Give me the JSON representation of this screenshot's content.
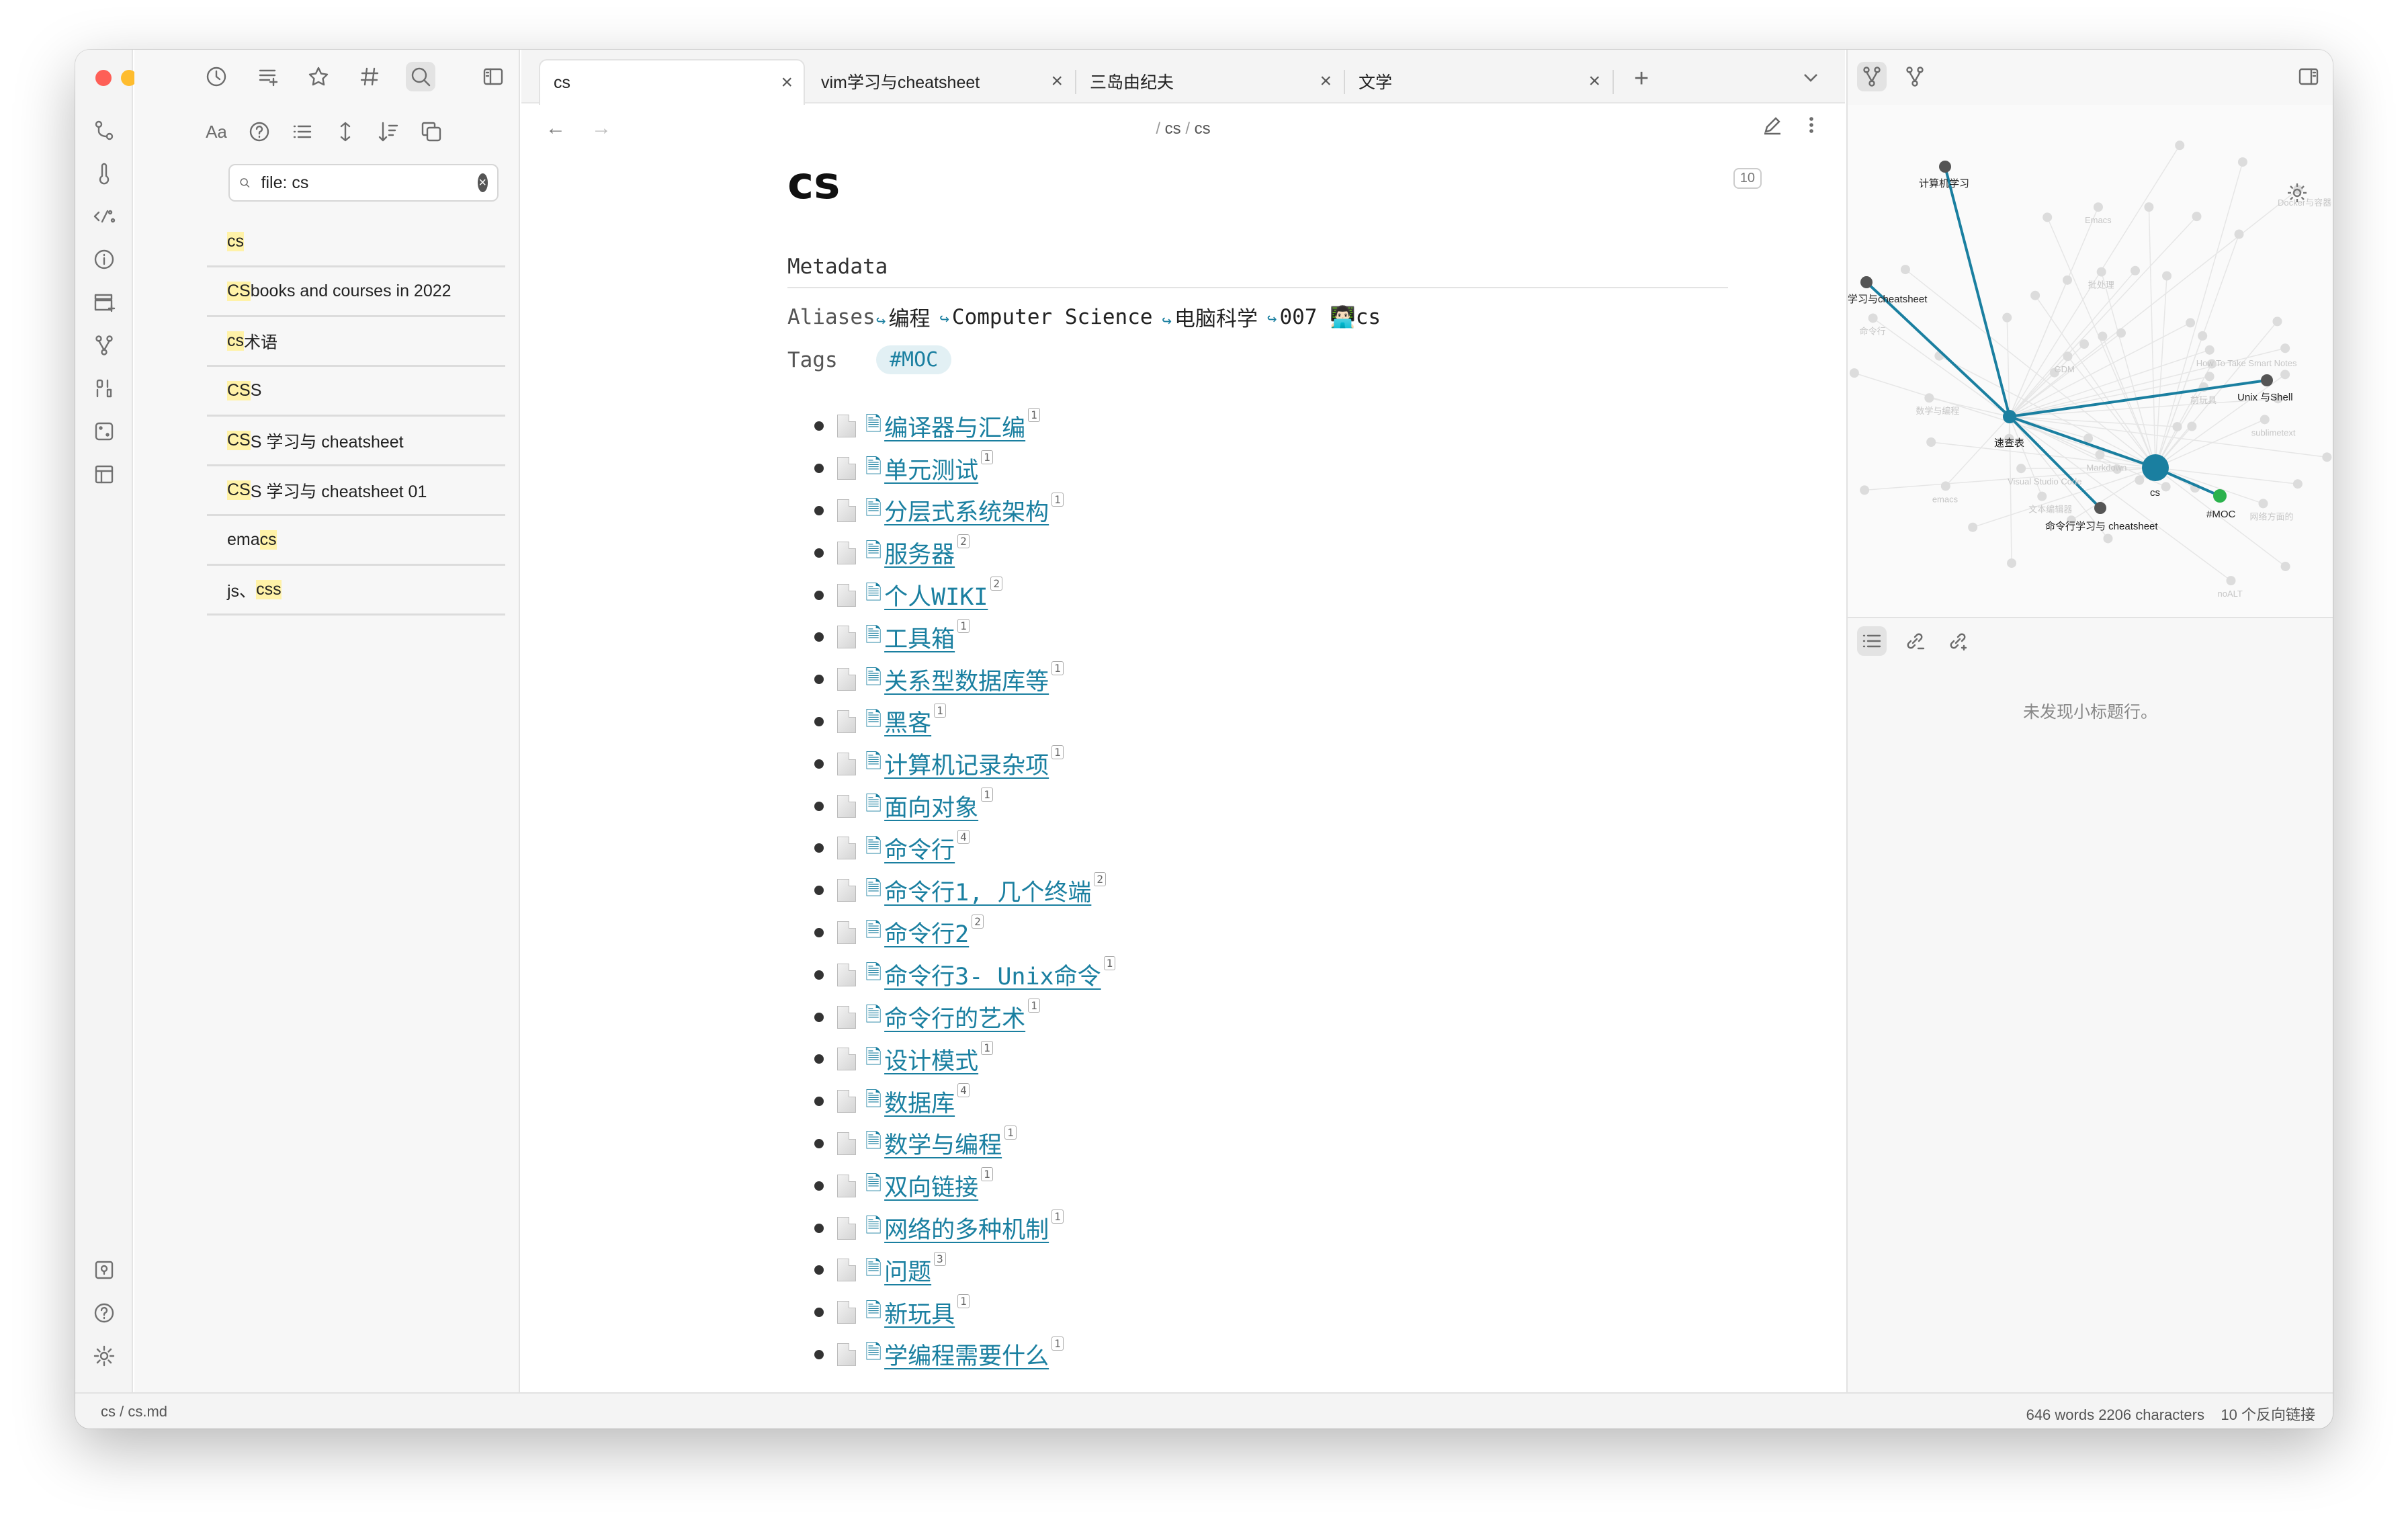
{
  "window": {
    "ribbon": [
      "graph-view-icon",
      "git-icon",
      "percent-code-icon",
      "info-icon",
      "add-card-icon",
      "branch-icon",
      "binary-icon",
      "dice-icon",
      "layout-icon"
    ],
    "ribbon_bottom": [
      "vault-icon",
      "help-icon",
      "settings-icon"
    ]
  },
  "left": {
    "search": {
      "query": "file: cs"
    },
    "search_options": {
      "match_case": "Aa"
    },
    "results": [
      {
        "hl": "cs",
        "rest": ""
      },
      {
        "hl": "CS",
        "rest": " books and courses in 2022"
      },
      {
        "hl": "cs",
        "rest": "术语"
      },
      {
        "hl": "CS",
        "rest": "S",
        "special": "css"
      },
      {
        "hl": "CS",
        "rest": "S 学习与 cheatsheet"
      },
      {
        "hl": "CS",
        "rest": "S 学习与 cheatsheet 01"
      },
      {
        "pre": "ema",
        "hl": "cs",
        "rest": ""
      },
      {
        "pre": "js、",
        "hl": "css",
        "rest": ""
      }
    ]
  },
  "tabs": [
    {
      "title": "cs",
      "active": true
    },
    {
      "title": "vim学习与cheatsheet"
    },
    {
      "title": "三岛由纪夫"
    },
    {
      "title": "文学"
    }
  ],
  "breadcrumb": {
    "sep": "/",
    "folder": "cs",
    "file": "cs"
  },
  "doc": {
    "title": "cs",
    "backlink_count": "10",
    "metadata_heading": "Metadata",
    "aliases_label": "Aliases",
    "aliases": [
      "编程",
      "Computer Science",
      "电脑科学",
      "007 👨🏻‍💻cs"
    ],
    "tags_label": "Tags",
    "tag": "#MOC",
    "links": [
      {
        "text": "编译器与汇编",
        "count": "1"
      },
      {
        "text": "单元测试",
        "count": "1"
      },
      {
        "text": "分层式系统架构",
        "count": "1"
      },
      {
        "text": "服务器",
        "count": "2"
      },
      {
        "text": "个人WIKI",
        "count": "2"
      },
      {
        "text": "工具箱",
        "count": "1"
      },
      {
        "text": "关系型数据库等",
        "count": "1"
      },
      {
        "text": "黑客",
        "count": "1"
      },
      {
        "text": "计算机记录杂项",
        "count": "1"
      },
      {
        "text": "面向对象",
        "count": "1"
      },
      {
        "text": "命令行",
        "count": "4"
      },
      {
        "text": "命令行1, 几个终端",
        "count": "2"
      },
      {
        "text": "命令行2",
        "count": "2"
      },
      {
        "text": "命令行3- Unix命令",
        "count": "1"
      },
      {
        "text": "命令行的艺术",
        "count": "1"
      },
      {
        "text": "设计模式",
        "count": "1"
      },
      {
        "text": "数据库",
        "count": "4"
      },
      {
        "text": "数学与编程",
        "count": "1"
      },
      {
        "text": "双向链接",
        "count": "1"
      },
      {
        "text": "网络的多种机制",
        "count": "1"
      },
      {
        "text": "问题",
        "count": "3"
      },
      {
        "text": "新玩具",
        "count": "1"
      },
      {
        "text": "学编程需要什么",
        "count": "1"
      }
    ]
  },
  "graph": {
    "labels": {
      "n1": "计算机学习",
      "n2": "学习与cheatsheet",
      "n3": "速查表",
      "n4": "cs",
      "n5": "#MOC",
      "n6": "Unix 与Shell",
      "n7": "命令行学习与 cheatsheet"
    },
    "faint_labels": [
      "前玩具",
      "网络方面的",
      "sublimetext",
      "noALT",
      "Markdown",
      "数学与编程",
      "Visual Studio Code",
      "命令行",
      "批处理",
      "Docker与容器",
      "文本编辑器",
      "How To Take Smart Notes",
      "emacs",
      "GDM",
      "Emacs"
    ],
    "accent": "#1a7fa0",
    "moc_color": "#2bb24c"
  },
  "outline": {
    "empty_text": "未发现小标题行。"
  },
  "status": {
    "path": "cs / cs.md",
    "counts": "646 words 2206 characters",
    "backlinks": "10 个反向链接"
  }
}
